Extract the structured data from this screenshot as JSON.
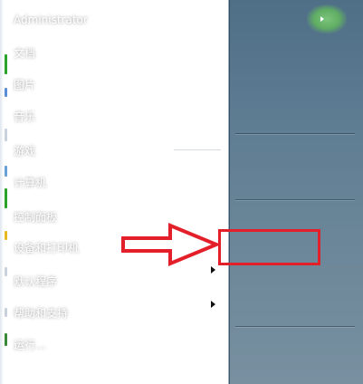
{
  "start_menu": {
    "user": {
      "name": "Administrator"
    },
    "right_items": [
      {
        "label": "文档"
      },
      {
        "label": "图片"
      },
      {
        "label": "音乐"
      },
      {
        "label": "游戏"
      },
      {
        "label": "计算机"
      },
      {
        "label": "控制面板"
      },
      {
        "label": "设备和打印机",
        "highlighted": true
      },
      {
        "label": "默认程序"
      },
      {
        "label": "帮助和支持"
      },
      {
        "label": "运行..."
      }
    ]
  },
  "annotation": {
    "highlight_color": "#e3202a",
    "arrow_color": "#e3202a"
  }
}
